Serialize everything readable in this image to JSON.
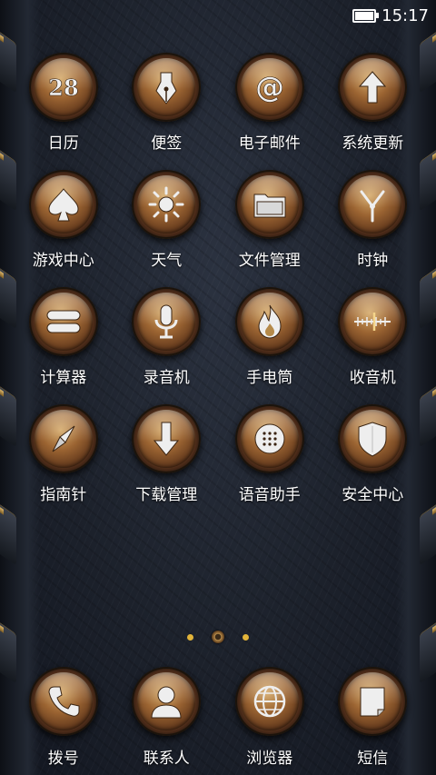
{
  "status_bar": {
    "time": "15:17",
    "battery_icon": "battery-icon"
  },
  "apps": [
    {
      "label": "日历",
      "icon": "calendar-icon"
    },
    {
      "label": "便签",
      "icon": "pen-nib-icon"
    },
    {
      "label": "电子邮件",
      "icon": "at-sign-icon"
    },
    {
      "label": "系统更新",
      "icon": "arrow-up-icon"
    },
    {
      "label": "游戏中心",
      "icon": "spade-icon"
    },
    {
      "label": "天气",
      "icon": "sun-icon"
    },
    {
      "label": "文件管理",
      "icon": "folder-icon"
    },
    {
      "label": "时钟",
      "icon": "clock-icon"
    },
    {
      "label": "计算器",
      "icon": "calculator-icon"
    },
    {
      "label": "录音机",
      "icon": "microphone-icon"
    },
    {
      "label": "手电筒",
      "icon": "flame-icon"
    },
    {
      "label": "收音机",
      "icon": "radio-dial-icon"
    },
    {
      "label": "指南针",
      "icon": "compass-icon"
    },
    {
      "label": "下载管理",
      "icon": "download-arrow-icon"
    },
    {
      "label": "语音助手",
      "icon": "speaker-grille-icon"
    },
    {
      "label": "安全中心",
      "icon": "shield-icon"
    }
  ],
  "calendar_glyph_text": "28",
  "pager": {
    "pages": 3,
    "current_page": 2
  },
  "dock": [
    {
      "label": "拨号",
      "icon": "phone-handset-icon"
    },
    {
      "label": "联系人",
      "icon": "person-silhouette-icon"
    },
    {
      "label": "浏览器",
      "icon": "globe-icon"
    },
    {
      "label": "短信",
      "icon": "message-icon"
    }
  ],
  "colors": {
    "gold": "#e2b43a",
    "bronze": "#8a5a2e",
    "background": "#1c212b"
  }
}
